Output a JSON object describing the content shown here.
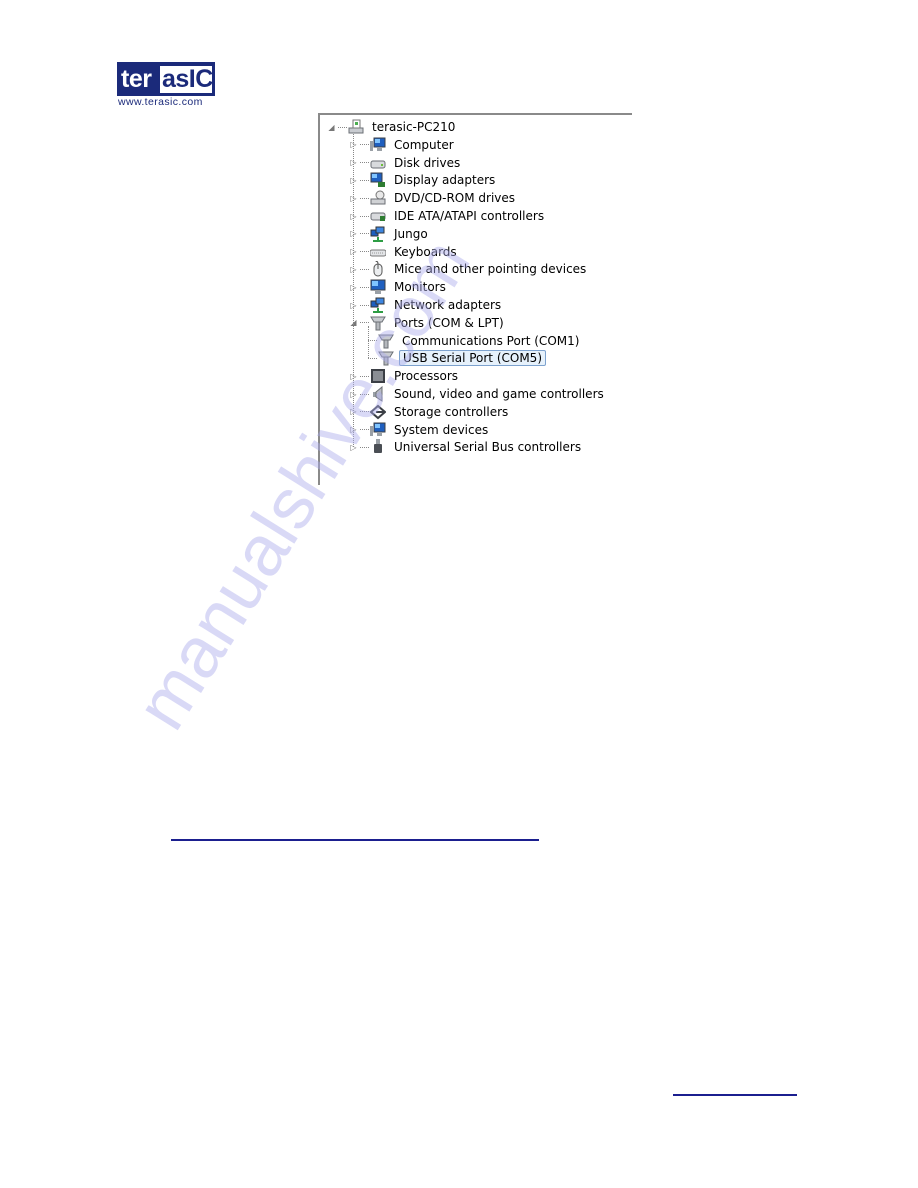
{
  "logo": {
    "brand_left": "ter",
    "brand_right": "asIC",
    "url": "www.terasic.com"
  },
  "device_tree": {
    "root": {
      "label": "terasic-PC210",
      "icon": "computer-root-icon",
      "expanded": true
    },
    "items": [
      {
        "label": "Computer",
        "icon": "computer-icon",
        "expanded": false
      },
      {
        "label": "Disk drives",
        "icon": "disk-drive-icon",
        "expanded": false
      },
      {
        "label": "Display adapters",
        "icon": "display-adapter-icon",
        "expanded": false
      },
      {
        "label": "DVD/CD-ROM drives",
        "icon": "dvd-drive-icon",
        "expanded": false
      },
      {
        "label": "IDE ATA/ATAPI controllers",
        "icon": "ide-controller-icon",
        "expanded": false
      },
      {
        "label": "Jungo",
        "icon": "network-icon",
        "expanded": false
      },
      {
        "label": "Keyboards",
        "icon": "keyboard-icon",
        "expanded": false
      },
      {
        "label": "Mice and other pointing devices",
        "icon": "mouse-icon",
        "expanded": false
      },
      {
        "label": "Monitors",
        "icon": "monitor-icon",
        "expanded": false
      },
      {
        "label": "Network adapters",
        "icon": "network-icon",
        "expanded": false
      },
      {
        "label": "Ports (COM & LPT)",
        "icon": "port-icon",
        "expanded": true,
        "children": [
          {
            "label": "Communications Port (COM1)",
            "icon": "port-icon",
            "selected": false
          },
          {
            "label": "USB Serial Port (COM5)",
            "icon": "port-icon",
            "selected": true
          }
        ]
      },
      {
        "label": "Processors",
        "icon": "processor-icon",
        "expanded": false
      },
      {
        "label": "Sound, video and game controllers",
        "icon": "speaker-icon",
        "expanded": false
      },
      {
        "label": "Storage controllers",
        "icon": "storage-icon",
        "expanded": false
      },
      {
        "label": "System devices",
        "icon": "computer-icon",
        "expanded": false
      },
      {
        "label": "Universal Serial Bus controllers",
        "icon": "usb-icon",
        "expanded": false
      }
    ]
  },
  "watermark": "manualshive.com",
  "colors": {
    "brand": "#1b2a7a",
    "link": "#1b1f8f",
    "selection_bg": "#e6f1fb",
    "selection_border": "#7da2ce"
  }
}
